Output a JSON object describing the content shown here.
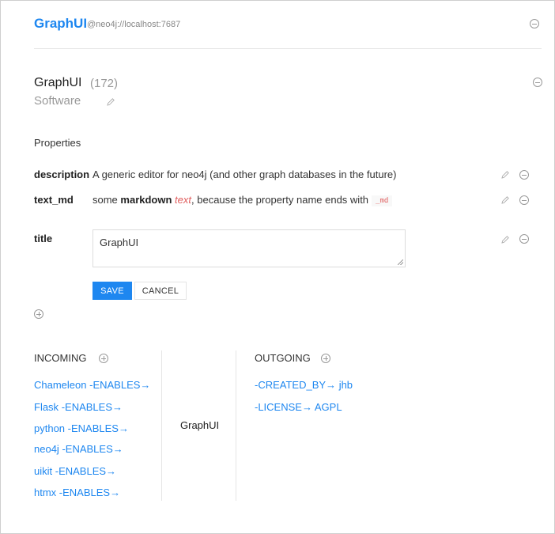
{
  "header": {
    "brand": "GraphUI",
    "connection": "@neo4j://localhost:7687"
  },
  "node": {
    "title": "GraphUI",
    "count": "(172)",
    "label": "Software"
  },
  "properties": {
    "heading": "Properties",
    "items": [
      {
        "key": "description",
        "value": "A generic editor for neo4j (and other graph databases in the future)"
      },
      {
        "key": "text_md",
        "value_parts": [
          "some ",
          "markdown",
          " ",
          "text",
          ", because the property name ends with",
          "_md"
        ]
      },
      {
        "key": "title",
        "value": "GraphUI"
      }
    ],
    "save_label": "SAVE",
    "cancel_label": "CANCEL"
  },
  "relationships": {
    "incoming_heading": "INCOMING",
    "outgoing_heading": "OUTGOING",
    "center_node": "GraphUI",
    "incoming": [
      {
        "node": "Chameleon",
        "rel": "-ENABLES→"
      },
      {
        "node": "Flask",
        "rel": "-ENABLES→"
      },
      {
        "node": "python",
        "rel": "-ENABLES→"
      },
      {
        "node": "neo4j",
        "rel": "-ENABLES→"
      },
      {
        "node": "uikit",
        "rel": "-ENABLES→"
      },
      {
        "node": "htmx",
        "rel": "-ENABLES→"
      }
    ],
    "outgoing": [
      {
        "rel": "-CREATED_BY→",
        "node": "jhb"
      },
      {
        "rel": "-LICENSE→",
        "node": "AGPL"
      }
    ]
  },
  "icons": {
    "remove": "minus-circle-icon",
    "add": "plus-circle-icon",
    "edit": "pencil-icon"
  },
  "colors": {
    "accent": "#1e87f0",
    "code": "#e05d5d",
    "muted": "#999999"
  }
}
